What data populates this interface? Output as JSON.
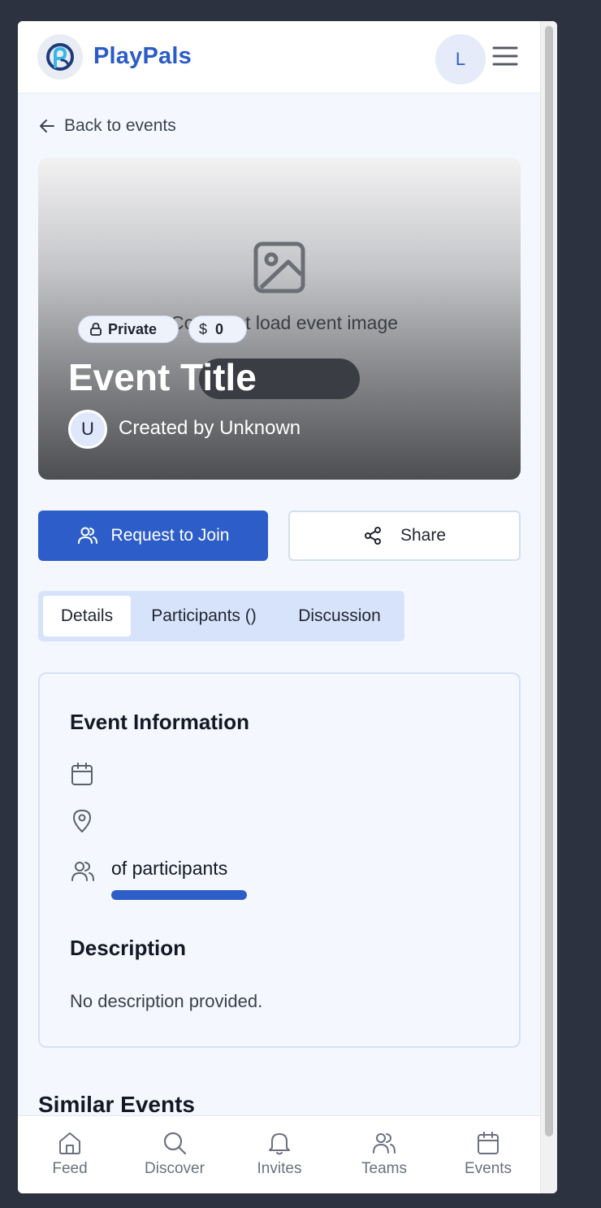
{
  "header": {
    "brand": "PlayPals",
    "avatar_initial": "L"
  },
  "back_link": "Back to events",
  "hero": {
    "image_error_text": "Could not load event image",
    "badges": {
      "visibility": "Private",
      "price_symbol": "$",
      "price": "0"
    },
    "title": "Event Title",
    "creator_initial": "U",
    "creator_text": "Created by Unknown"
  },
  "actions": {
    "join_label": "Request to Join",
    "share_label": "Share"
  },
  "tabs": {
    "details": "Details",
    "participants": "Participants ()",
    "discussion": "Discussion"
  },
  "event_info": {
    "title": "Event Information",
    "date": "",
    "location": "",
    "participants": " of participants",
    "capacity_fill": 1.0
  },
  "description": {
    "title": "Description",
    "text": "No description provided."
  },
  "similar_events": {
    "title": "Similar Events"
  },
  "bottom_nav": {
    "feed": "Feed",
    "discover": "Discover",
    "invites": "Invites",
    "teams": "Teams",
    "events": "Events"
  },
  "colors": {
    "primary": "#2d5dc8",
    "brand": "#2a5cc7",
    "background": "#f4f7fd",
    "tab_bg": "#d7e3fa"
  }
}
